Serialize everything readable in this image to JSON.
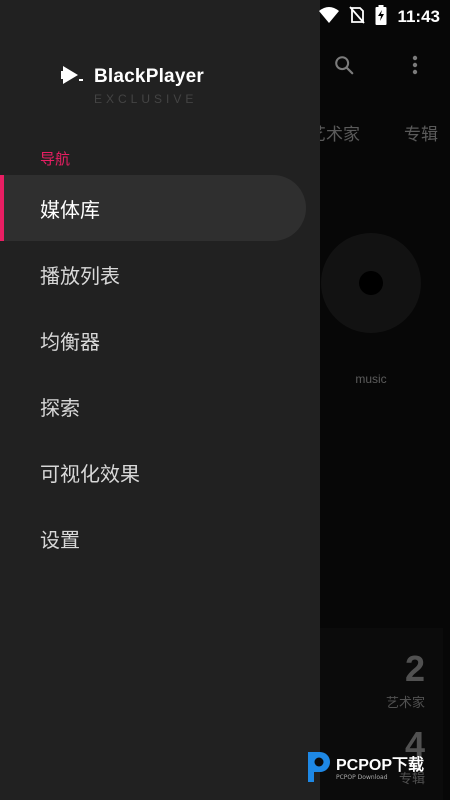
{
  "status_bar": {
    "time": "11:43",
    "icons": [
      "wifi-icon",
      "no-sim-icon",
      "battery-charging-icon"
    ]
  },
  "background": {
    "toolbar_icons": [
      "search-icon",
      "more-vert-icon"
    ],
    "tabs": [
      "艺术家",
      "专辑"
    ],
    "album": {
      "label": "music"
    },
    "stats": [
      {
        "value": "2",
        "label": "艺术家"
      },
      {
        "value": "4",
        "label": "专辑"
      }
    ]
  },
  "drawer": {
    "app_name": "BlackPlayer",
    "app_edition": "EXCLUSIVE",
    "section_header": "导航",
    "accent_color": "#e91e63",
    "items": [
      {
        "label": "媒体库",
        "active": true
      },
      {
        "label": "播放列表",
        "active": false
      },
      {
        "label": "均衡器",
        "active": false
      },
      {
        "label": "探索",
        "active": false
      },
      {
        "label": "可视化效果",
        "active": false
      },
      {
        "label": "设置",
        "active": false
      }
    ]
  },
  "watermark": {
    "text": "PCPOP下载",
    "sub": "PCPOP Download"
  }
}
